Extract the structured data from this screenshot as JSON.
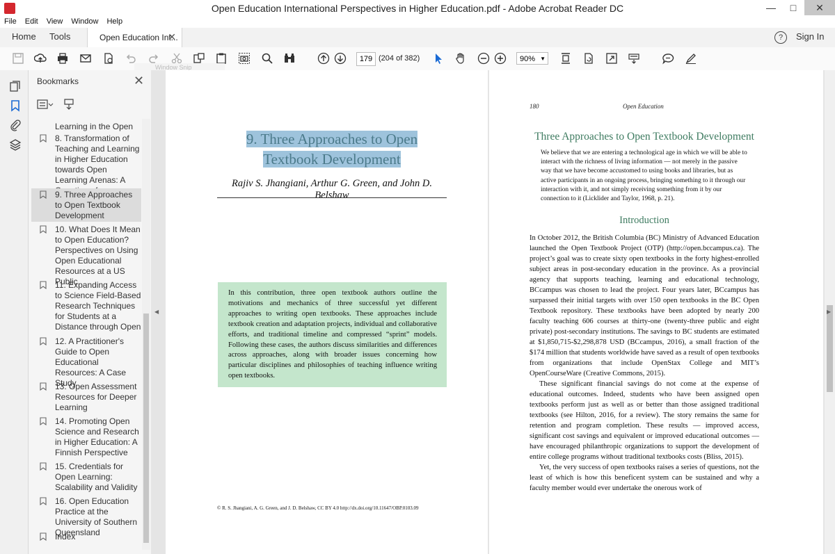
{
  "window": {
    "title": "Open Education International Perspectives in Higher Education.pdf - Adobe Acrobat Reader DC"
  },
  "menu": [
    "File",
    "Edit",
    "View",
    "Window",
    "Help"
  ],
  "tabs": {
    "home": "Home",
    "tools": "Tools",
    "document": "Open Education Int...",
    "sign_in": "Sign In"
  },
  "toolbar": {
    "page_current": "179",
    "page_count": "(204 of 382)",
    "zoom": "90%",
    "snip_tooltip": "Window Snip"
  },
  "bookmarks": {
    "title": "Bookmarks",
    "items": [
      {
        "label": "Learning in the Open",
        "selected": false,
        "flag": false
      },
      {
        "label": "8. Transformation of Teaching and Learning in Higher Education towards Open Learning Arenas: A Question of",
        "selected": false,
        "flag": true
      },
      {
        "label": "9. Three Approaches to Open Textbook Development",
        "selected": true,
        "flag": true
      },
      {
        "label": "10. What Does It Mean to Open Education? Perspectives on Using Open Educational Resources at a US Public",
        "selected": false,
        "flag": true
      },
      {
        "label": "11. Expanding Access to Science Field-Based Research Techniques for Students at a Distance through Open",
        "selected": false,
        "flag": true
      },
      {
        "label": "12. A Practitioner's Guide to Open Educational Resources: A Case Study",
        "selected": false,
        "flag": true
      },
      {
        "label": "13. Open Assessment Resources for Deeper Learning",
        "selected": false,
        "flag": true
      },
      {
        "label": "14. Promoting Open Science and Research in Higher Education: A Finnish Perspective",
        "selected": false,
        "flag": true
      },
      {
        "label": "15. Credentials for Open Learning: Scalability and Validity",
        "selected": false,
        "flag": true
      },
      {
        "label": "16. Open Education Practice at the University of Southern Queensland",
        "selected": false,
        "flag": true
      },
      {
        "label": "Index",
        "selected": false,
        "flag": true
      }
    ]
  },
  "left_page": {
    "chapter_title_line1": "9. Three Approaches to Open",
    "chapter_title_line2": "Textbook Development",
    "authors": "Rajiv S. Jhangiani, Arthur G. Green, and John D. Belshaw",
    "abstract": "In this contribution, three open textbook authors outline the motivations and mechanics of three successful yet different approaches to writing open textbooks. These approaches include textbook creation and adaptation projects, individual and collaborative efforts, and traditional timeline and compressed “sprint” models. Following these cases, the authors discuss similarities and differences across approaches, along with broader issues concerning how particular disciplines and philosophies of teaching influence writing open textbooks.",
    "footnote": "© R. S. Jhangiani, A. G. Green, and J. D. Belshaw, CC BY 4.0     http://dx.doi.org/10.11647/OBP.0103.09"
  },
  "right_page": {
    "page_number": "180",
    "running_title": "Open Education",
    "section_heading": "Three Approaches to Open Textbook Development",
    "quote": "We believe that we are entering a technological age in which we will be able to interact with the richness of living information — not merely in the passive way that we have become accustomed to using books and libraries, but as active participants in an ongoing process, bringing something to it through our interaction with it, and not simply receiving something from it by our connection to it (Licklider and Taylor, 1968, p. 21).",
    "intro_heading": "Introduction",
    "paragraphs": [
      "In October 2012, the British Columbia (BC) Ministry of Advanced Education launched the Open Textbook Project (OTP) (http://open.bccampus.ca). The project’s goal was to create sixty open textbooks in the forty highest-enrolled subject areas in post-secondary education in the province. As a provincial agency that supports teaching, learning and educational technology, BCcampus was chosen to lead the project. Four years later, BCcampus has surpassed their initial targets with over 150 open textbooks in the BC Open Textbook repository. These textbooks have been adopted by nearly 200 faculty teaching 606 courses at thirty-one (twenty-three public and eight private) post-secondary institutions. The savings to BC students are estimated at $1,850,715-$2,298,878 USD (BCcampus, 2016), a small fraction of the $174 million that students worldwide have saved as a result of open textbooks from organizations that include OpenStax College and MIT’s OpenCourseWare (Creative Commons, 2015).",
      "These significant financial savings do not come at the expense of educational outcomes. Indeed, students who have been assigned open textbooks perform just as well as or better than those assigned traditional textbooks (see Hilton, 2016, for a review). The story remains the same for retention and program completion. These results — improved access, significant cost savings and equivalent or improved educational outcomes — have encouraged philanthropic organizations to support the development of entire college programs without traditional textbooks costs (Bliss, 2015).",
      "Yet, the very success of open textbooks raises a series of questions, not the least of which is how this beneficent system can be sustained and why a faculty member would ever undertake the onerous work of"
    ]
  }
}
